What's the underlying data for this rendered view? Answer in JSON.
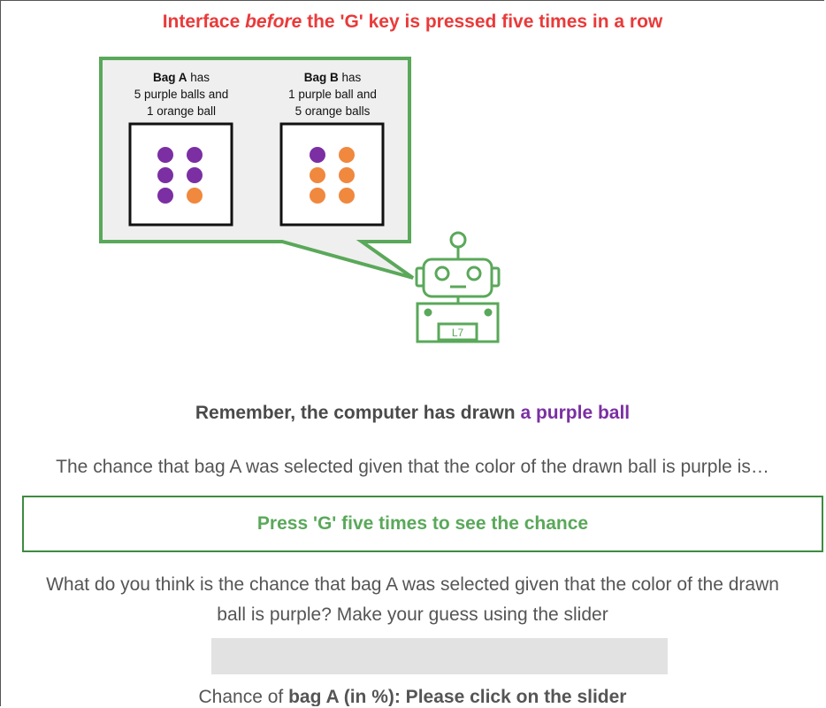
{
  "heading": {
    "part1": "Interface ",
    "emphasis": "before",
    "part2": " the 'G' key is pressed five times in a row"
  },
  "bag_a": {
    "name": "Bag A",
    "has": " has",
    "line2": "5 purple balls and",
    "line3": "1 orange ball",
    "balls": [
      "purple",
      "purple",
      "purple",
      "purple",
      "purple",
      "orange"
    ]
  },
  "bag_b": {
    "name": "Bag B",
    "has": " has",
    "line2": "1 purple ball and",
    "line3": "5 orange balls",
    "balls": [
      "purple",
      "orange",
      "orange",
      "orange",
      "orange",
      "orange"
    ]
  },
  "robot": {
    "label": "L7"
  },
  "remember": {
    "prefix": "Remember, the computer has drawn ",
    "highlight": "a purple ball"
  },
  "chance_question": "The chance that bag A was selected given that the color of the drawn ball is purple is…",
  "reveal_button_label": "Press 'G' five times to see the chance",
  "guess_question": {
    "line1": "What do you think is the chance that bag A was selected given that the color of the drawn",
    "line2": "ball is purple? Make your guess using the slider"
  },
  "chance_label": {
    "prefix": "Chance of ",
    "bold": "bag A (in %): Please click on the slider"
  },
  "colors": {
    "heading_red": "#ea3a3a",
    "purple_ball": "#7b2fa3",
    "orange_ball": "#f0883e",
    "green_accent": "#5aa85a",
    "bubble_fill": "#efefef",
    "slider_track": "#e2e2e2"
  }
}
